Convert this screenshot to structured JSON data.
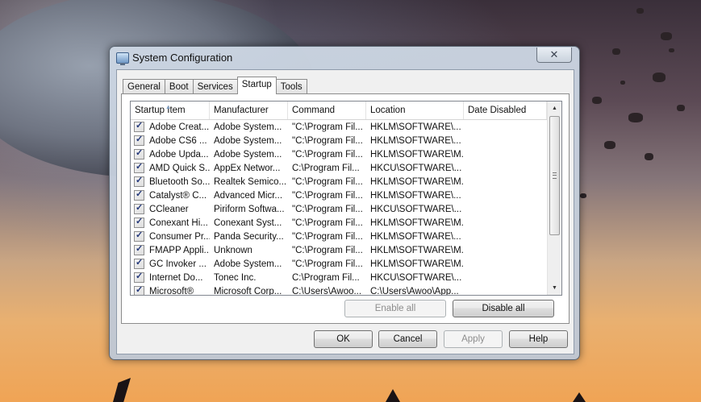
{
  "window": {
    "title": "System Configuration",
    "close_symbol": "✕"
  },
  "tabs": [
    {
      "label": "General",
      "active": false
    },
    {
      "label": "Boot",
      "active": false
    },
    {
      "label": "Services",
      "active": false
    },
    {
      "label": "Startup",
      "active": true
    },
    {
      "label": "Tools",
      "active": false
    }
  ],
  "table": {
    "columns": [
      "Startup Item",
      "Manufacturer",
      "Command",
      "Location",
      "Date Disabled"
    ],
    "rows": [
      {
        "item": "Adobe Creat...",
        "manufacturer": "Adobe System...",
        "command": "\"C:\\Program Fil...",
        "location": "HKLM\\SOFTWARE\\...",
        "date_disabled": "",
        "checked": true
      },
      {
        "item": "Adobe CS6 ...",
        "manufacturer": "Adobe System...",
        "command": "\"C:\\Program Fil...",
        "location": "HKLM\\SOFTWARE\\...",
        "date_disabled": "",
        "checked": true
      },
      {
        "item": "Adobe Upda...",
        "manufacturer": "Adobe System...",
        "command": "\"C:\\Program Fil...",
        "location": "HKLM\\SOFTWARE\\M...",
        "date_disabled": "",
        "checked": true
      },
      {
        "item": "AMD Quick S...",
        "manufacturer": "AppEx Networ...",
        "command": "C:\\Program Fil...",
        "location": "HKCU\\SOFTWARE\\...",
        "date_disabled": "",
        "checked": true
      },
      {
        "item": "Bluetooth So...",
        "manufacturer": "Realtek Semico...",
        "command": "\"C:\\Program Fil...",
        "location": "HKLM\\SOFTWARE\\M...",
        "date_disabled": "",
        "checked": true
      },
      {
        "item": "Catalyst® C...",
        "manufacturer": "Advanced Micr...",
        "command": "\"C:\\Program Fil...",
        "location": "HKLM\\SOFTWARE\\...",
        "date_disabled": "",
        "checked": true
      },
      {
        "item": "CCleaner",
        "manufacturer": "Piriform Softwa...",
        "command": "\"C:\\Program Fil...",
        "location": "HKCU\\SOFTWARE\\...",
        "date_disabled": "",
        "checked": true
      },
      {
        "item": "Conexant Hi...",
        "manufacturer": "Conexant Syst...",
        "command": "\"C:\\Program Fil...",
        "location": "HKLM\\SOFTWARE\\M...",
        "date_disabled": "",
        "checked": true
      },
      {
        "item": "Consumer Pr...",
        "manufacturer": "Panda Security...",
        "command": "\"C:\\Program Fil...",
        "location": "HKLM\\SOFTWARE\\...",
        "date_disabled": "",
        "checked": true
      },
      {
        "item": "FMAPP Appli...",
        "manufacturer": "Unknown",
        "command": "\"C:\\Program Fil...",
        "location": "HKLM\\SOFTWARE\\M...",
        "date_disabled": "",
        "checked": true
      },
      {
        "item": "GC Invoker ...",
        "manufacturer": "Adobe System...",
        "command": "\"C:\\Program Fil...",
        "location": "HKLM\\SOFTWARE\\M...",
        "date_disabled": "",
        "checked": true
      },
      {
        "item": "Internet Do...",
        "manufacturer": "Tonec Inc.",
        "command": "C:\\Program Fil...",
        "location": "HKCU\\SOFTWARE\\...",
        "date_disabled": "",
        "checked": true
      },
      {
        "item": "Microsoft®",
        "manufacturer": "Microsoft Corp...",
        "command": "C:\\Users\\Awoo...",
        "location": "C:\\Users\\Awoo\\App...",
        "date_disabled": "",
        "checked": true
      }
    ]
  },
  "buttons": {
    "enable_all": "Enable all",
    "disable_all": "Disable all",
    "ok": "OK",
    "cancel": "Cancel",
    "apply": "Apply",
    "help": "Help"
  },
  "scrollbar": {
    "up_arrow": "▲",
    "down_arrow": "▼"
  }
}
